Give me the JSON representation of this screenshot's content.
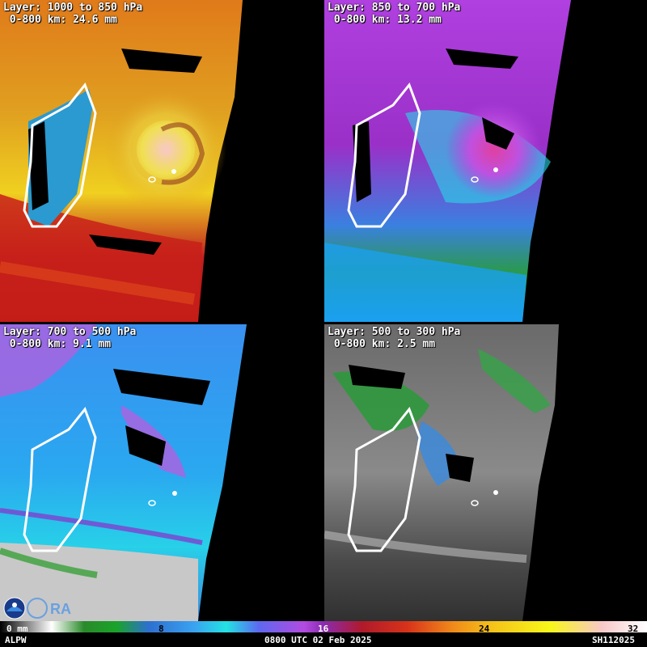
{
  "panels": [
    {
      "title": "Layer: 1000 to 850 hPa",
      "value": "0-800 km: 24.6 mm"
    },
    {
      "title": "Layer: 850 to 700 hPa",
      "value": "0-800 km: 13.2 mm"
    },
    {
      "title": "Layer: 700 to 500 hPa",
      "value": "0-800 km: 9.1 mm"
    },
    {
      "title": "Layer: 500 to 300 hPa",
      "value": "0-800 km: 2.5 mm"
    }
  ],
  "colorbar": {
    "ticks": [
      "0 mm",
      "8",
      "16",
      "24",
      "32"
    ],
    "colors": [
      "#000000",
      "#ffffff",
      "#1aa32a",
      "#3aa2f0",
      "#23e3e3",
      "#b34be0",
      "#b01a2a",
      "#f08a1a",
      "#f7f71a",
      "#f8c8c8"
    ]
  },
  "footer": {
    "product": "ALPW",
    "time": "0800 UTC 02 Feb 2025",
    "storm_id": "SH112025"
  },
  "logos": [
    "noaa-logo",
    "cira-logo"
  ]
}
